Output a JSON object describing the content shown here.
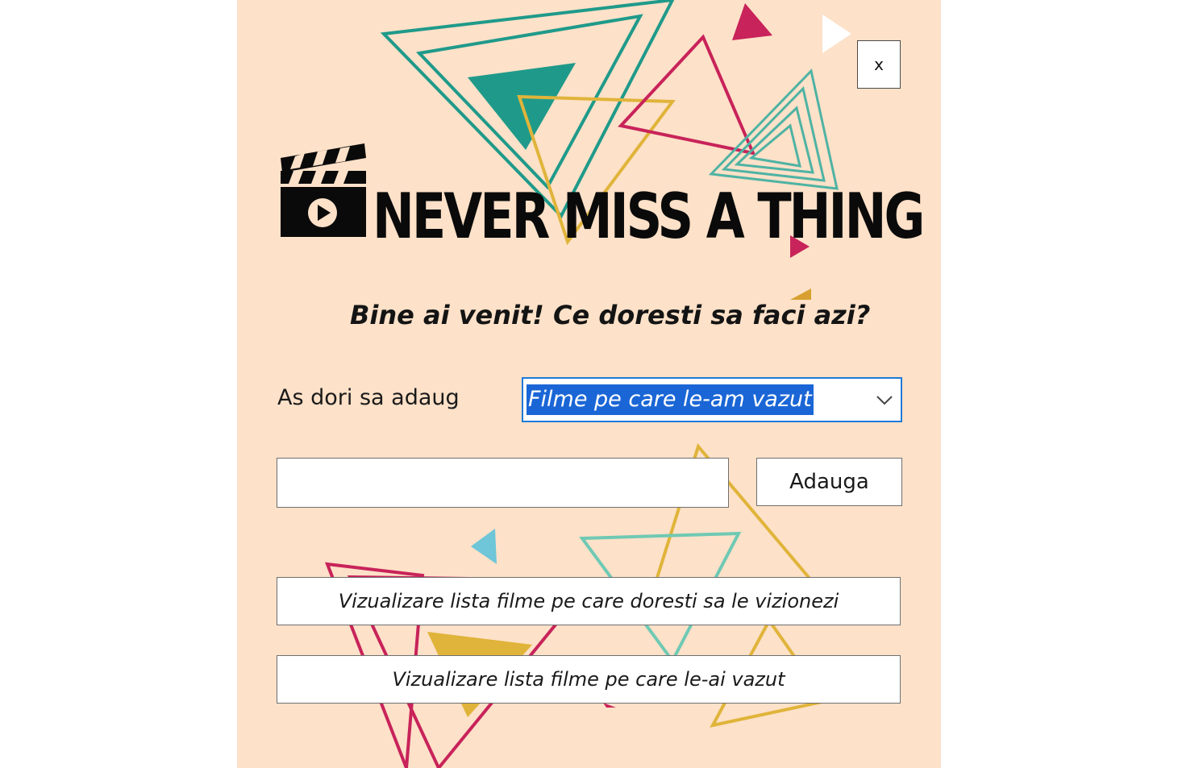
{
  "window": {
    "close_label": "x",
    "background_color": "#fde1c8"
  },
  "logo": {
    "text": "NEVER MISS A THING",
    "icon": "clapperboard-play-icon"
  },
  "welcome_text": "Bine ai venit! Ce doresti sa faci azi?",
  "add_section": {
    "label": "As dori sa adaug",
    "category_select": {
      "selected": "Filme pe care le-am vazut"
    },
    "title_input": {
      "value": "",
      "placeholder": ""
    },
    "add_button": "Adauga"
  },
  "actions": {
    "view_watchlist": "Vizualizare lista filme pe care doresti sa le vizionezi",
    "view_seen": "Vizualizare lista filme pe care le-ai vazut"
  },
  "colors": {
    "teal": "#1f9a8a",
    "crimson": "#c8235a",
    "mustard": "#e0b43a",
    "sky": "#6ec6d8",
    "selection": "#1a66d6"
  }
}
